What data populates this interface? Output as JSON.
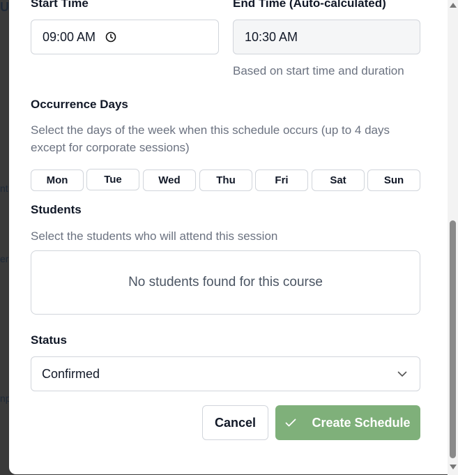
{
  "backdrop": {
    "fragments": [
      "U",
      "nt",
      "er",
      "np"
    ]
  },
  "form": {
    "start_time": {
      "label": "Start Time",
      "value": "09:00 AM",
      "icon": "clock-icon"
    },
    "end_time": {
      "label": "End Time (Auto-calculated)",
      "value": "10:30 AM",
      "help": "Based on start time and duration"
    },
    "occurrence": {
      "label": "Occurrence Days",
      "help": "Select the days of the week when this schedule occurs (up to 4 days except for corporate sessions)",
      "days": [
        "Mon",
        "Tue",
        "Wed",
        "Thu",
        "Fri",
        "Sat",
        "Sun"
      ]
    },
    "students": {
      "label": "Students",
      "help": "Select the students who will attend this session",
      "empty": "No students found for this course"
    },
    "status": {
      "label": "Status",
      "value": "Confirmed",
      "icon": "chevron-down-icon"
    }
  },
  "actions": {
    "cancel": "Cancel",
    "create": "Create Schedule",
    "create_icon": "check-icon",
    "create_color": "#7fb07a"
  }
}
